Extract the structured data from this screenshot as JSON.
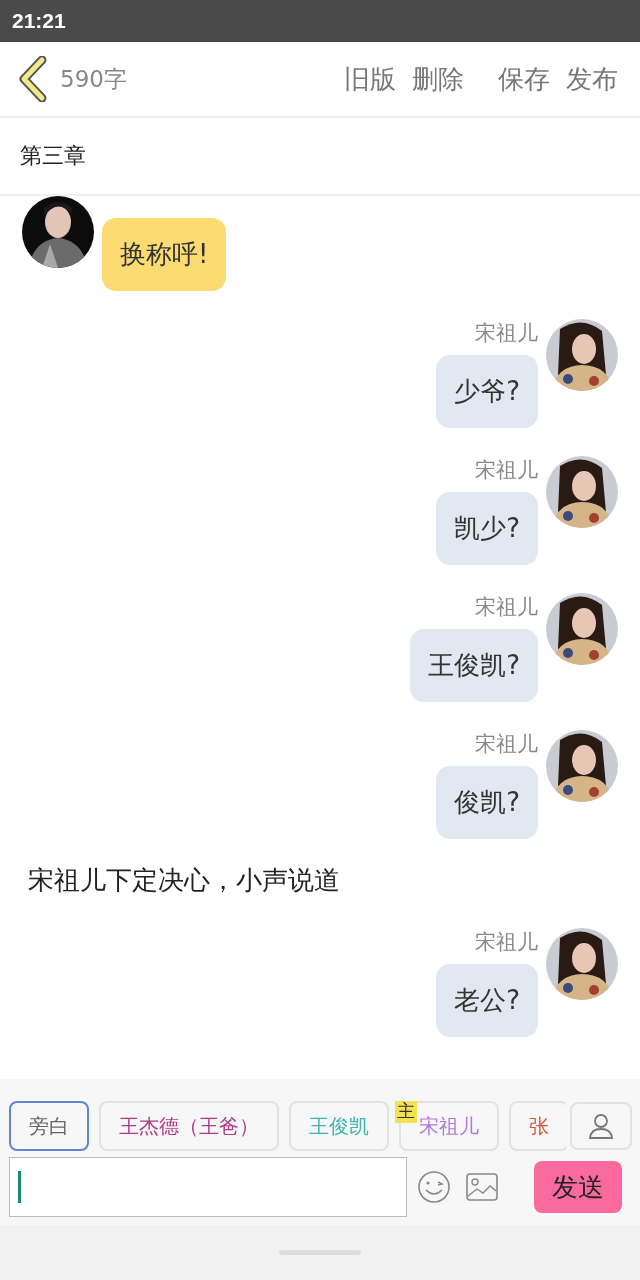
{
  "status_bar": {
    "time": "21:21"
  },
  "header": {
    "word_count": "590字",
    "actions": [
      "旧版",
      "删除",
      "保存",
      "发布"
    ]
  },
  "chapter_title": "第三章",
  "messages": [
    {
      "kind": "left",
      "text": "换称呼!"
    },
    {
      "kind": "right",
      "name": "宋祖儿",
      "text": "少爷?"
    },
    {
      "kind": "right",
      "name": "宋祖儿",
      "text": "凯少?"
    },
    {
      "kind": "right",
      "name": "宋祖儿",
      "text": "王俊凯?"
    },
    {
      "kind": "right",
      "name": "宋祖儿",
      "text": "俊凯?"
    },
    {
      "kind": "narration",
      "text": "宋祖儿下定决心，小声说道"
    },
    {
      "kind": "right",
      "name": "宋祖儿",
      "text": "老公?"
    }
  ],
  "characters": [
    {
      "label": "旁白",
      "selected": true,
      "color": "#666666"
    },
    {
      "label": "王杰德（王爸）",
      "selected": false,
      "color": "#b03a86"
    },
    {
      "label": "王俊凯",
      "selected": false,
      "color": "#3bb5ad"
    },
    {
      "label": "宋祖儿",
      "selected": false,
      "color": "#b07ad6",
      "badge": "主"
    },
    {
      "label": "张",
      "selected": false,
      "color": "#d9553a"
    }
  ],
  "composer": {
    "send": "发送"
  }
}
